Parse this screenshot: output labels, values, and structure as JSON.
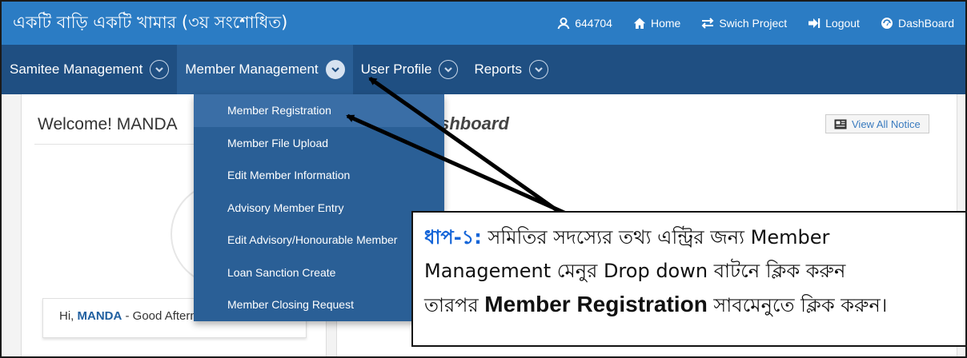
{
  "app_title": "একটি বাড়ি একটি খামার (৩য় সংশোধিত)",
  "topnav": {
    "user_id": "644704",
    "home": "Home",
    "switch_project": "Swich Project",
    "logout": "Logout",
    "dashboard": "DashBoard"
  },
  "menu": {
    "samitee": "Samitee Management",
    "member": "Member Management",
    "profile": "User Profile",
    "reports": "Reports"
  },
  "dropdown": [
    "Member Registration",
    "Member File Upload",
    "Edit Member Information",
    "Advisory Member Entry",
    "Edit Advisory/Honourable Member",
    "Loan Sanction Create",
    "Member Closing Request"
  ],
  "welcome_text": "Welcome! MANDA",
  "dashboard_heading": "Dashboard",
  "view_notice": "View All Notice",
  "greeting": {
    "prefix": "Hi,",
    "name": "MANDA",
    "suffix": " - Good Afternoon"
  },
  "callout": {
    "step": "ধাপ-১:",
    "line1": " সমিতির সদস্যের তথ্য এন্ট্রির জন্য Member",
    "line2": "Management মেনুর Drop down বাটনে ক্লিক করুন",
    "line3_prefix": "তারপর ",
    "line3_bold": "Member Registration",
    "line3_suffix": " সাবমেনুতে ক্লিক করুন।"
  },
  "colors": {
    "topbar": "#2b7cc4",
    "menubar": "#1f4f82",
    "dropdown": "#2a5f96",
    "step_label": "#1565d8"
  }
}
